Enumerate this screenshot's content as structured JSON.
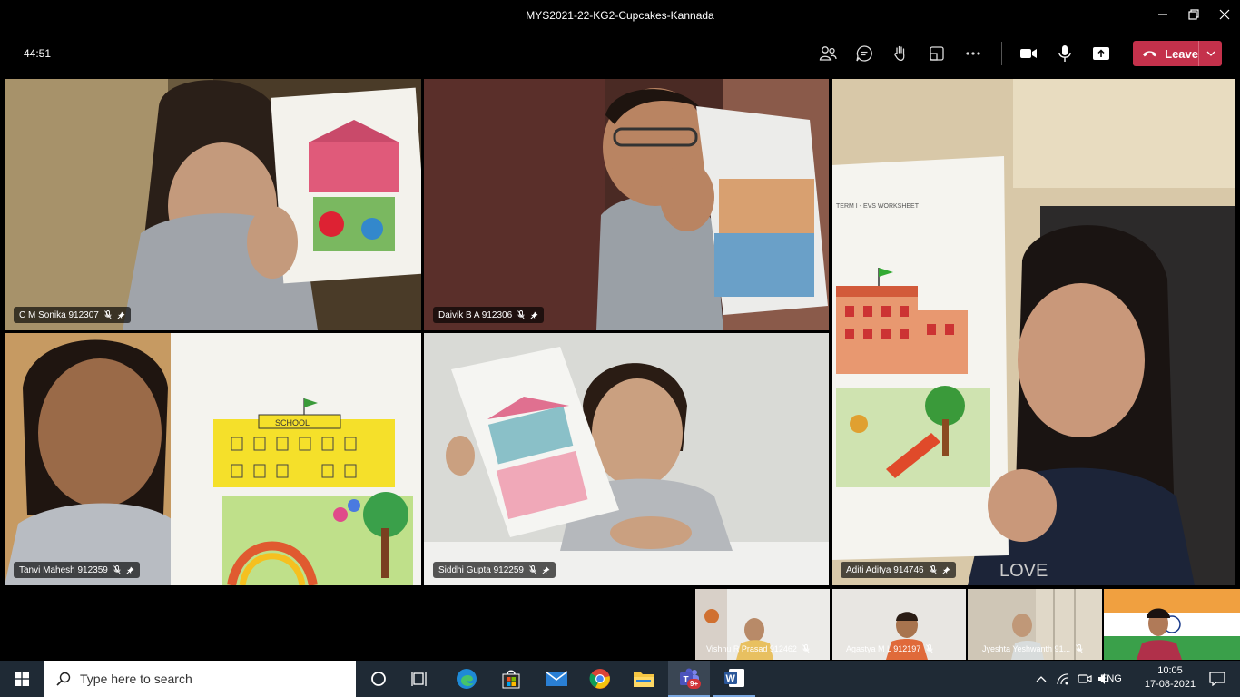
{
  "window": {
    "title": "MYS2021-22-KG2-Cupcakes-Kannada",
    "icons": [
      "minimize-icon",
      "maximize-icon",
      "close-icon"
    ]
  },
  "meeting": {
    "timer": "44:51",
    "controls": [
      "participants-icon",
      "chat-icon",
      "raise-hand-icon",
      "rooms-icon",
      "more-actions-icon",
      "camera-icon",
      "mic-icon",
      "share-icon"
    ],
    "leave_label": "Leave"
  },
  "participants": [
    {
      "name": "C M Sonika 912307"
    },
    {
      "name": "Daivik B A 912306"
    },
    {
      "name": "Aditi Aditya 914746"
    },
    {
      "name": "Tanvi Mahesh 912359"
    },
    {
      "name": "Siddhi Gupta 912259"
    }
  ],
  "thumbnails": [
    {
      "name": "Vishnu R Prasad 912462"
    },
    {
      "name": "Agastya M L 912197"
    },
    {
      "name": "Jyeshta Yeshwanth 91..."
    },
    {
      "name": ""
    }
  ],
  "drawings": {
    "school_sign": "SCHOOL",
    "worksheet_heading": "TERM I - EVS WORKSHEET",
    "shirt_text": "LOVE"
  },
  "taskbar": {
    "search_placeholder": "Type here to search",
    "apps": [
      "task-view-icon",
      "edge-icon",
      "store-icon",
      "mail-icon",
      "chrome-icon",
      "file-explorer-icon",
      "teams-icon",
      "word-icon"
    ],
    "teams_badge": "9+",
    "language": "ENG",
    "time": "10:05",
    "date": "17-08-2021"
  },
  "colors": {
    "leave": "#c4314b",
    "taskbar": "#1f2a35",
    "background": "#000000"
  }
}
